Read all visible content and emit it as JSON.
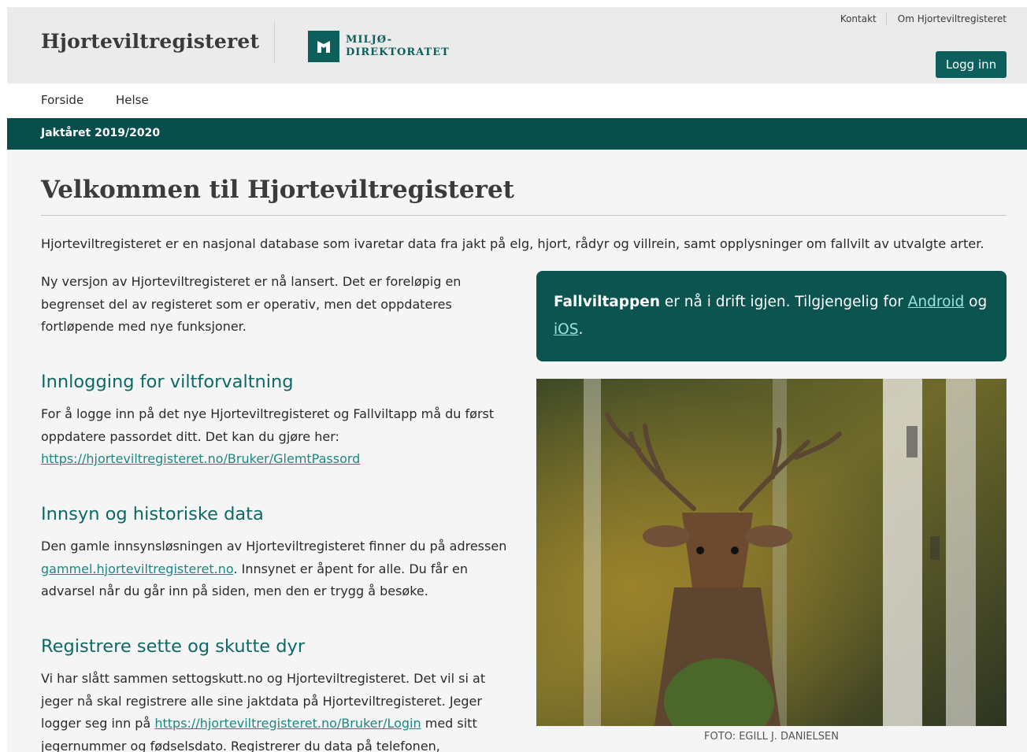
{
  "header": {
    "site_title": "Hjorteviltregisteret",
    "logo": {
      "line1": "MILJØ-",
      "line2": "DIREKTORATET",
      "icon": "miljodirektoratet-logo-icon"
    },
    "top_links": [
      "Kontakt",
      "Om Hjorteviltregisteret"
    ],
    "login_label": "Logg inn"
  },
  "nav": {
    "items": [
      "Forside",
      "Helse"
    ]
  },
  "season": {
    "label": "Jaktåret 2019/2020"
  },
  "main": {
    "heading": "Velkommen til Hjorteviltregisteret",
    "intro": "Hjorteviltregisteret er en nasjonal database som ivaretar data fra jakt på elg, hjort, rådyr og villrein, samt opplysninger om fallvilt av utvalgte arter.",
    "new_version": "Ny versjon av Hjorteviltregisteret er nå lansert. Det er foreløpig en begrenset del av registeret som er operativ, men det oppdateres fortløpende med nye funksjoner.",
    "sections": [
      {
        "title": "Innlogging for viltforvaltning",
        "text_before": "For å logge inn på det nye Hjorteviltregisteret og Fallviltapp må du først oppdatere passordet ditt. Det kan du gjøre her: ",
        "link": "https://hjorteviltregisteret.no/Bruker/GlemtPassord",
        "text_after": ""
      },
      {
        "title": "Innsyn og historiske data",
        "text_before": "Den gamle innsynsløsningen av Hjorteviltregisteret finner du på adressen ",
        "link": "gammel.hjorteviltregisteret.no",
        "text_after": ". Innsynet er åpent for alle. Du får en advarsel når du går inn på siden, men den er trygg å besøke."
      },
      {
        "title": "Registrere sette og skutte dyr",
        "text_before": "Vi har slått sammen settogskutt.no og Hjorteviltregisteret. Det vil si at jeger nå skal registrere alle sine jaktdata på Hjorteviltregisteret. Jeger logger seg inn på ",
        "link": "https://hjorteviltregisteret.no/Bruker/Login",
        "text_after": " med sitt jegernummer og fødselsdato. Registrerer du data på telefonen,"
      }
    ]
  },
  "app_box": {
    "bold": "Fallviltappen",
    "text": " er nå i drift igjen. Tilgjengelig for ",
    "android": "Android",
    "and": " og ",
    "ios": "iOS",
    "end": "."
  },
  "photo": {
    "credit": "FOTO: EGILL J. DANIELSEN"
  },
  "colors": {
    "brand": "#0c5f5b",
    "season_bar": "#084e4b",
    "section_title": "#0d6965",
    "link": "#1a8883"
  }
}
